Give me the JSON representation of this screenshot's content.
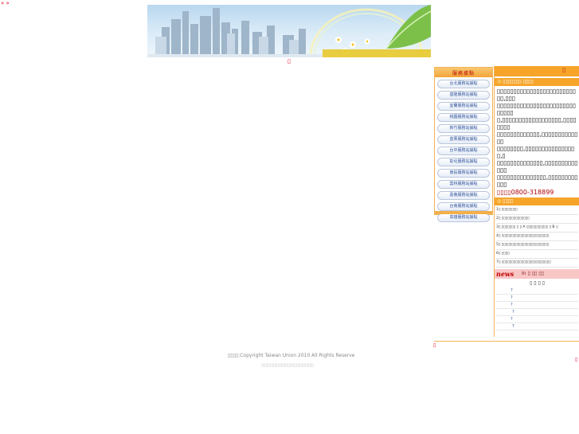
{
  "corner_mark": "« »",
  "under_banner_glyph": "▯",
  "services": {
    "title": "服務據點",
    "items": [
      "台北服務站據點",
      "基隆服務站據點",
      "宜蘭服務站據點",
      "桃園服務站據點",
      "新竹服務站據點",
      "苗栗服務站據點",
      "台中服務站據點",
      "彰化服務站據點",
      "南投服務站據點",
      "雲林服務站據點",
      "嘉義服務站據點",
      "台南服務站據點",
      "高雄服務站據點"
    ]
  },
  "right": {
    "top_glyph": "▯",
    "notice_title": "▯▯▯▯▯▯▯-▯▯▯▯",
    "notice_lines": [
      "▯▯▯▯▯▯▯▯▯▯▯▯▯▯▯▯▯▯▯▯▯▯▯▯▯▯,▯▯▯",
      "▯▯▯▯▯▯▯▯▯▯▯▯▯▯▯▯▯▯▯▯▯▯▯▯▯▯▯▯▯",
      "▯,▯▯▯▯▯▯▯▯▯▯▯▯▯▯▯▯▯▯,▯▯▯▯▯▯▯▯",
      "▯▯▯▯▯▯▯▯▯▯▯▯▯,▯▯▯▯▯▯▯▯▯▯▯▯▯",
      "▯▯▯▯▯▯▯▯,▯▯▯▯▯▯▯▯▯▯▯▯▯▯▯▯,▯",
      "▯▯▯▯▯▯▯▯▯▯▯▯▯▯,▯▯▯▯▯▯▯▯▯▯▯▯▯",
      "▯▯▯▯▯▯▯▯▯▯▯▯▯▯▯,▯▯▯▯▯▯▯▯▯▯▯▯"
    ],
    "notice_phone": "▯▯▯▯0800-318899",
    "links_title": "▯▯▯▯",
    "links": [
      "1▯ ▯▯▯▯▯▯▯▯",
      "2▯ ▯▯▯▯▯▯▯▯▯▯▯▯▯▯",
      "3▯ ▯▯▯▯▯▯▯ ▯  ▯ A ▯▯▯▯▯▯▯▯▯▯▯  ▯ B ▯",
      "4▯ ▯▯▯▯▯▯▯▯▯▯▯▯▯▯▯▯▯▯▯▯▯▯▯▯",
      "5▯ ▯▯▯▯▯▯▯▯▯▯▯▯▯▯▯▯▯▯▯▯▯▯▯▯",
      "6▯ ▯▯▯▯",
      "7▯ ▯▯▯▯▯▯▯▯▯▯▯▯▯▯▯▯▯▯▯▯▯▯▯▯▯"
    ],
    "news_logo": "news",
    "news_sub": "In ▯ ▯▯ ▯▯",
    "news_head": "▯ ▯ ▯ ▯",
    "news_rows": [
      "?",
      "?",
      "?",
      "?",
      "?",
      "?"
    ]
  },
  "red_glyph_left": "▯",
  "red_glyph_right": "▯",
  "footer": {
    "copyright": "▯▯▯▯:Copyright  Taiwan Union 2010 All Rights Reserve",
    "note": "▯▯▯▯▯▯▯▯▯▯▯▯▯▯▯▯▯▯▯▯▯▯▯▯"
  },
  "colors": {
    "orange": "#f6a52a",
    "accent_red": "#e0001a",
    "link_blue": "#2a4f9a"
  }
}
